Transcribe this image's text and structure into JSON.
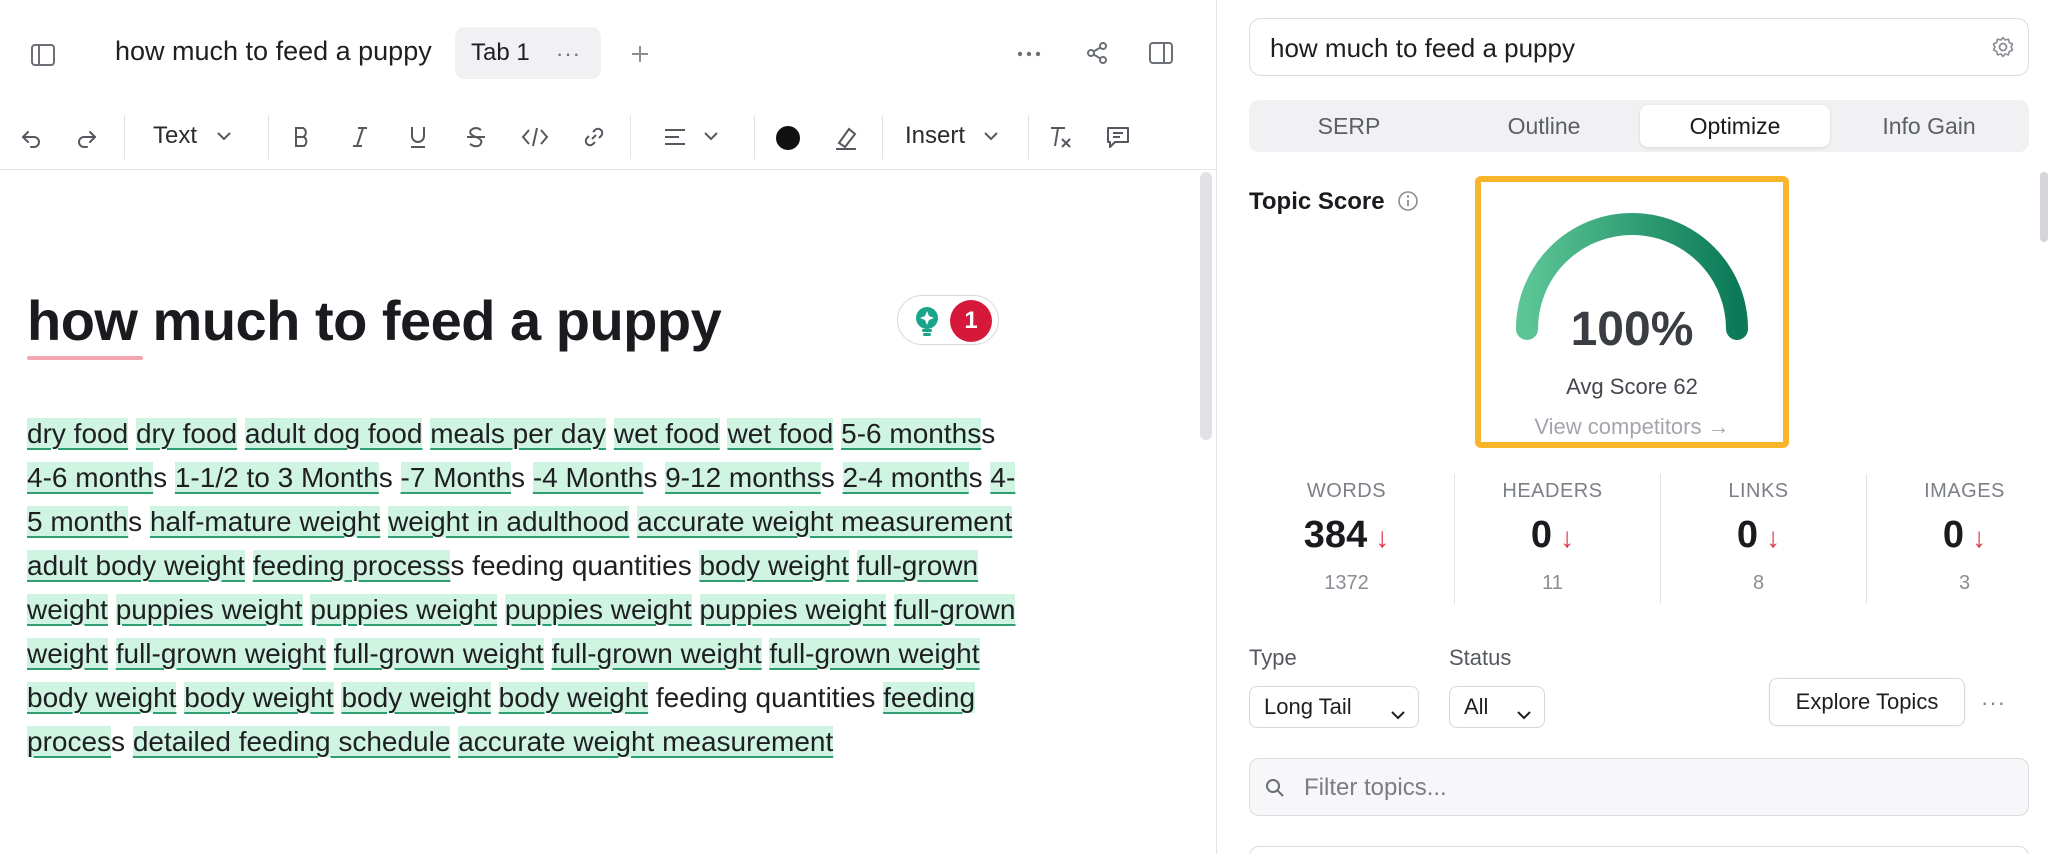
{
  "header": {
    "doc_title": "how much to feed a puppy",
    "tab_label": "Tab 1",
    "tab_menu_glyph": "···",
    "icons": [
      "sidebar-toggle-icon",
      "plus-icon",
      "more-icon",
      "share-icon",
      "panel-toggle-icon"
    ]
  },
  "toolbar": {
    "text_style_label": "Text",
    "insert_label": "Insert",
    "text_color": "#111111",
    "icons": [
      "undo-icon",
      "redo-icon",
      "bold-icon",
      "italic-icon",
      "underline-icon",
      "strikethrough-icon",
      "code-icon",
      "link-icon",
      "align-icon",
      "text-color-icon",
      "highlighter-icon",
      "clear-format-icon",
      "comment-icon"
    ]
  },
  "document": {
    "heading": "how much to feed a puppy",
    "suggestion_count": "1",
    "paragraph": [
      {
        "t": "dry food",
        "kw": true
      },
      {
        "t": " "
      },
      {
        "t": "dry food",
        "kw": true
      },
      {
        "t": " "
      },
      {
        "t": "adult dog food",
        "kw": true
      },
      {
        "t": " "
      },
      {
        "t": "meals per day",
        "kw": true
      },
      {
        "t": " "
      },
      {
        "t": "wet food",
        "kw": true
      },
      {
        "t": " "
      },
      {
        "t": "wet food",
        "kw": true
      },
      {
        "t": " "
      },
      {
        "t": "5-6 months",
        "kw": true
      },
      {
        "t": "s "
      },
      {
        "t": "4-6 month",
        "kw": true
      },
      {
        "t": "s "
      },
      {
        "t": "1-1/2 to 3 Month",
        "kw": true
      },
      {
        "t": "s "
      },
      {
        "t": "-7 Month",
        "kw": true
      },
      {
        "t": "s "
      },
      {
        "t": "-4 Month",
        "kw": true
      },
      {
        "t": "s "
      },
      {
        "t": "9-12 months",
        "kw": true
      },
      {
        "t": "s "
      },
      {
        "t": "2-4 month",
        "kw": true
      },
      {
        "t": "s "
      },
      {
        "t": "4-5 month",
        "kw": true
      },
      {
        "t": "s "
      },
      {
        "t": "half-mature weight",
        "kw": true
      },
      {
        "t": " "
      },
      {
        "t": "weight in adulthood",
        "kw": true
      },
      {
        "t": " "
      },
      {
        "t": "accurate weight measurement",
        "kw": true
      },
      {
        "t": " "
      },
      {
        "t": "adult body weight",
        "kw": true
      },
      {
        "t": " "
      },
      {
        "t": "feeding process",
        "kw": true
      },
      {
        "t": "s feeding quantities "
      },
      {
        "t": "body weight",
        "kw": true
      },
      {
        "t": " "
      },
      {
        "t": "full-grown weight",
        "kw": true
      },
      {
        "t": " "
      },
      {
        "t": "puppies weight",
        "kw": true
      },
      {
        "t": " "
      },
      {
        "t": "puppies weight",
        "kw": true
      },
      {
        "t": " "
      },
      {
        "t": "puppies weight",
        "kw": true
      },
      {
        "t": " "
      },
      {
        "t": "puppies weight",
        "kw": true
      },
      {
        "t": " "
      },
      {
        "t": "full-grown weight",
        "kw": true
      },
      {
        "t": " "
      },
      {
        "t": "full-grown weight",
        "kw": true
      },
      {
        "t": " "
      },
      {
        "t": "full-grown weight",
        "kw": true
      },
      {
        "t": " "
      },
      {
        "t": "full-grown weight",
        "kw": true
      },
      {
        "t": " "
      },
      {
        "t": "full-grown weight",
        "kw": true
      },
      {
        "t": " "
      },
      {
        "t": "body weight",
        "kw": true
      },
      {
        "t": " "
      },
      {
        "t": "body weight",
        "kw": true
      },
      {
        "t": " "
      },
      {
        "t": "body weight",
        "kw": true
      },
      {
        "t": " "
      },
      {
        "t": "body weight",
        "kw": true
      },
      {
        "t": " feeding quantities "
      },
      {
        "t": "feeding proces",
        "kw": true
      },
      {
        "t": "s "
      },
      {
        "t": "detailed feeding schedule",
        "kw": true
      },
      {
        "t": " "
      },
      {
        "t": "accurate weight measurement",
        "kw": true
      }
    ]
  },
  "panel": {
    "search_query": "how much to feed a puppy",
    "tabs": [
      {
        "label": "SERP",
        "active": false
      },
      {
        "label": "Outline",
        "active": false
      },
      {
        "label": "Optimize",
        "active": true
      },
      {
        "label": "Info Gain",
        "active": false
      }
    ],
    "topic_score_label": "Topic Score",
    "score": {
      "percent": "100%",
      "value": 1.0,
      "avg_score_label": "Avg Score 62",
      "view_competitors_label": "View competitors →",
      "gauge_colors": [
        "#5cc596",
        "#0c7a58"
      ],
      "highlight_color": "#f8b42a"
    },
    "stats": [
      {
        "label": "WORDS",
        "value": "384",
        "target": "1372",
        "trend": "↓"
      },
      {
        "label": "HEADERS",
        "value": "0",
        "target": "11",
        "trend": "↓"
      },
      {
        "label": "LINKS",
        "value": "0",
        "target": "8",
        "trend": "↓"
      },
      {
        "label": "IMAGES",
        "value": "0",
        "target": "3",
        "trend": "↓"
      }
    ],
    "filters": {
      "type_label": "Type",
      "type_value": "Long Tail",
      "status_label": "Status",
      "status_value": "All",
      "explore_label": "Explore Topics",
      "more_glyph": "···",
      "filter_placeholder": "Filter topics..."
    }
  }
}
